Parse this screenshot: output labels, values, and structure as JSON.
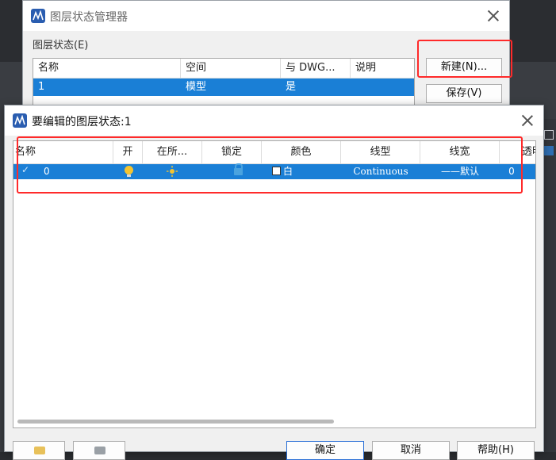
{
  "back_dialog": {
    "title": "图层状态管理器",
    "section_label": "图层状态(E)",
    "columns": [
      "名称",
      "空间",
      "与 DWG...",
      "说明"
    ],
    "rows": [
      {
        "name": "1",
        "space": "模型",
        "same_as_dwg": "是",
        "desc": ""
      }
    ],
    "buttons": {
      "new": "新建(N)...",
      "save": "保存(V)"
    }
  },
  "front_dialog": {
    "title": "要编辑的图层状态:1",
    "columns": [
      "名称",
      "开",
      "在所...",
      "锁定",
      "颜色",
      "线型",
      "线宽",
      "透明"
    ],
    "rows": [
      {
        "name": "0",
        "on": true,
        "frozen_icon": "sun-icon",
        "lock_icon": "unlock-icon",
        "color_name": "白",
        "color_hex": "#ffffff",
        "linetype": "Continuous",
        "lineweight": "——默认",
        "transparency": "0"
      }
    ],
    "buttons": {
      "ok": "确定",
      "cancel": "取消",
      "help": "帮助(H)"
    }
  },
  "colors": {
    "selection": "#1a7fd6",
    "highlight": "#ff2a2a",
    "app_icon": "#2a5db0"
  }
}
